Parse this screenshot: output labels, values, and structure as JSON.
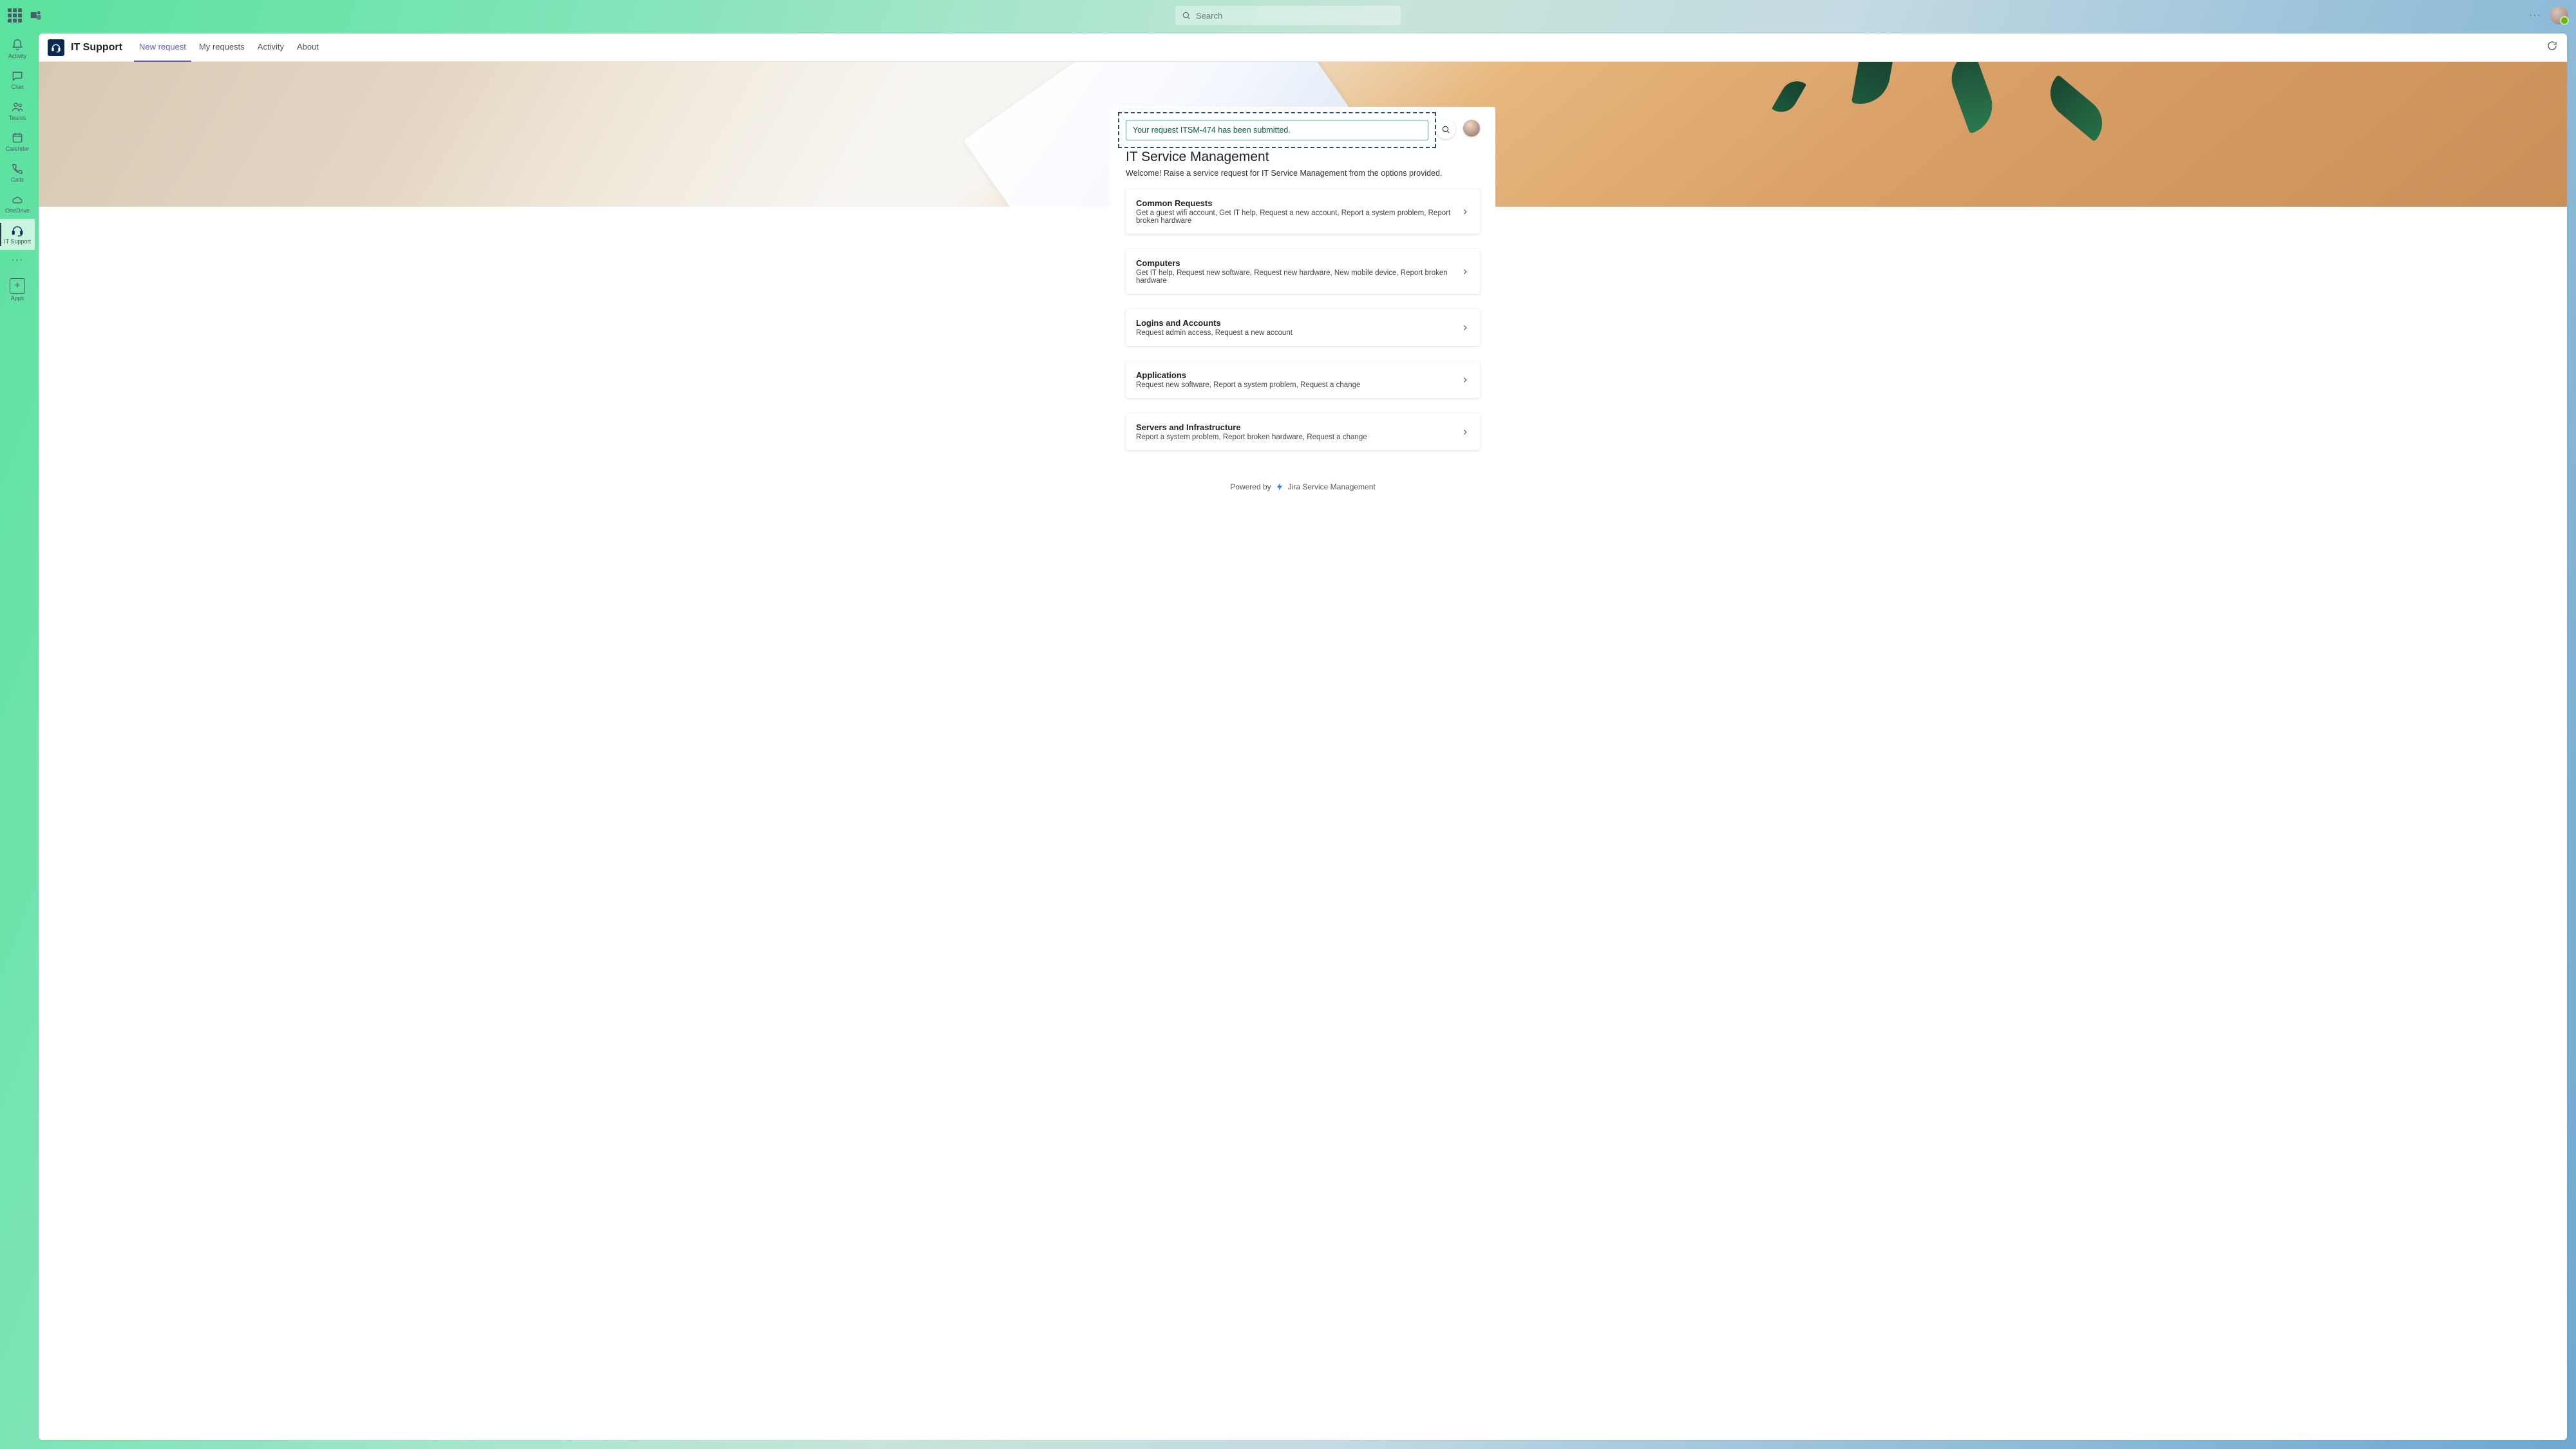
{
  "search": {
    "placeholder": "Search"
  },
  "rail": {
    "activity": "Activity",
    "chat": "Chat",
    "teams": "Teams",
    "calendar": "Calendar",
    "calls": "Calls",
    "onedrive": "OneDrive",
    "itsupport": "IT Support",
    "apps": "Apps"
  },
  "app": {
    "title": "IT Support"
  },
  "tabs": {
    "new_request": "New request",
    "my_requests": "My requests",
    "activity": "Activity",
    "about": "About"
  },
  "notice": "Your request ITSM-474 has been submitted.",
  "portal": {
    "title": "IT Service Management",
    "subtitle": "Welcome! Raise a service request for IT Service Management from the options provided."
  },
  "categories": [
    {
      "title": "Common Requests",
      "desc": "Get a guest wifi account, Get IT help, Request a new account, Report a system problem, Report broken hardware"
    },
    {
      "title": "Computers",
      "desc": "Get IT help, Request new software, Request new hardware, New mobile device, Report broken hardware"
    },
    {
      "title": "Logins and Accounts",
      "desc": "Request admin access, Request a new account"
    },
    {
      "title": "Applications",
      "desc": "Request new software, Report a system problem, Request a change"
    },
    {
      "title": "Servers and Infrastructure",
      "desc": "Report a system problem, Report broken hardware, Request a change"
    }
  ],
  "footer": {
    "prefix": "Powered by",
    "product": "Jira Service Management"
  }
}
